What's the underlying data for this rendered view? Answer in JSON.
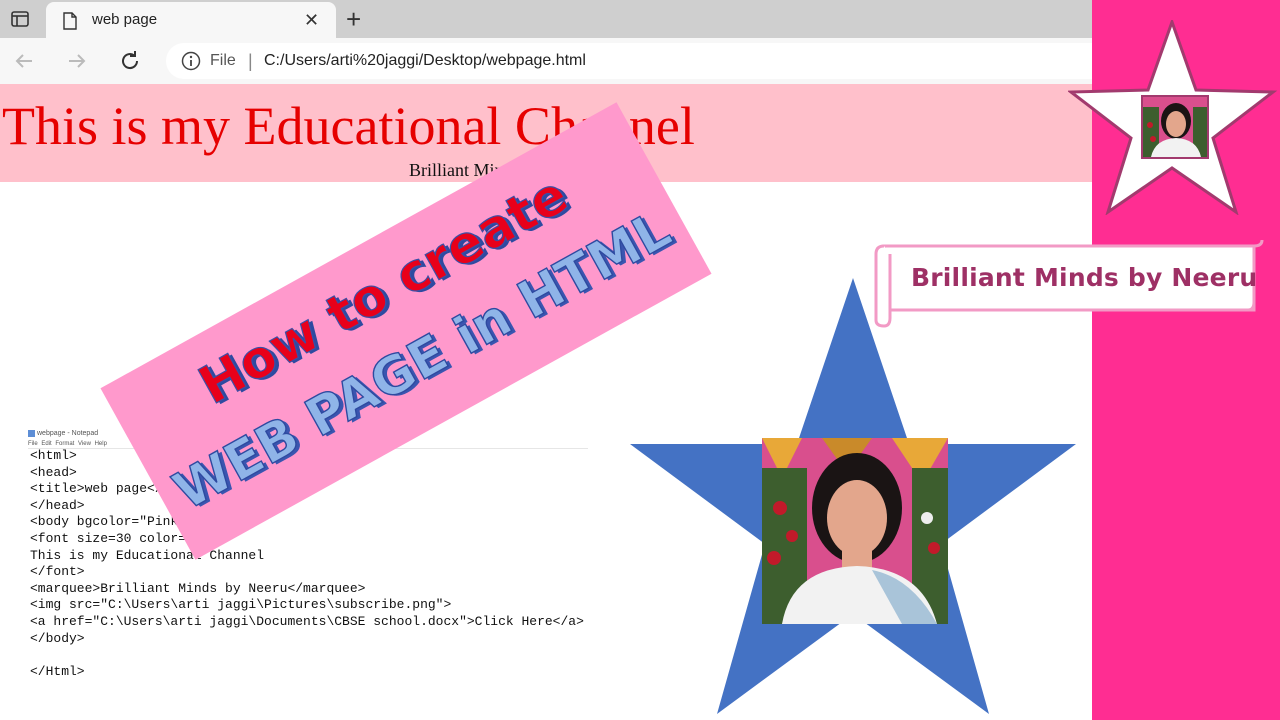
{
  "browser": {
    "tab_title": "web page",
    "address_scheme": "File",
    "address_separator": "|",
    "address_url": "C:/Users/arti%20jaggi/Desktop/webpage.html"
  },
  "page": {
    "heading": "This is my Educational Channel",
    "marquee": "Brilliant Minds by Neeru"
  },
  "notepad": {
    "title": "webpage - Notepad",
    "menu": "File Edit Format View Help",
    "code_lines": [
      "<html>",
      "<head>",
      "<title>web page</title>",
      "</head>",
      "<body bgcolor=\"Pink\">",
      "<font size=30 color=\"red\">",
      "This is my Educational Channel",
      "</font>",
      "<marquee>Brilliant Minds by Neeru</marquee>",
      "<img src=\"C:\\Users\\arti jaggi\\Pictures\\subscribe.png\">",
      "<a href=\"C:\\Users\\arti jaggi\\Documents\\CBSE school.docx\">Click Here</a>",
      "</body>",
      "",
      "</Html>"
    ]
  },
  "banner": {
    "line1": "How to create",
    "line2": "WEB PAGE in HTML"
  },
  "side": {
    "scroll_label": "Brilliant Minds by Neeru"
  },
  "colors": {
    "page_bg_pink": "#ffc0cb",
    "heading_red": "#e60000",
    "banner_pink": "#ff99cc",
    "star_blue": "#4472c4",
    "side_panel": "#ff2d92",
    "scroll_text": "#9e3065"
  }
}
